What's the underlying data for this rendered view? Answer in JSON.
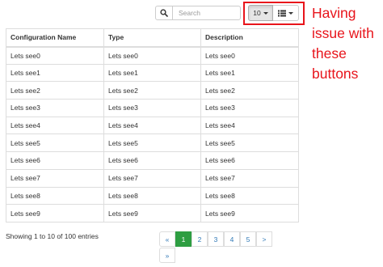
{
  "toolbar": {
    "search_placeholder": "Search",
    "page_size": "10",
    "search_icon": "search-icon",
    "columns_icon": "list-icon"
  },
  "annotation": {
    "lines": [
      "Having",
      "issue with",
      "these",
      "buttons"
    ],
    "color": "#e8141b"
  },
  "table": {
    "headers": [
      "Configuration Name",
      "Type",
      "Description"
    ],
    "rows": [
      [
        "Lets see0",
        "Lets see0",
        "Lets see0"
      ],
      [
        "Lets see1",
        "Lets see1",
        "Lets see1"
      ],
      [
        "Lets see2",
        "Lets see2",
        "Lets see2"
      ],
      [
        "Lets see3",
        "Lets see3",
        "Lets see3"
      ],
      [
        "Lets see4",
        "Lets see4",
        "Lets see4"
      ],
      [
        "Lets see5",
        "Lets see5",
        "Lets see5"
      ],
      [
        "Lets see6",
        "Lets see6",
        "Lets see6"
      ],
      [
        "Lets see7",
        "Lets see7",
        "Lets see7"
      ],
      [
        "Lets see8",
        "Lets see8",
        "Lets see8"
      ],
      [
        "Lets see9",
        "Lets see9",
        "Lets see9"
      ]
    ]
  },
  "footer": {
    "info": "Showing 1 to 10 of 100 entries"
  },
  "pagination": {
    "first": "«",
    "pages": [
      "1",
      "2",
      "3",
      "4",
      "5"
    ],
    "active_page": "1",
    "next": ">",
    "last": "»",
    "active_color": "#2e9e42"
  }
}
